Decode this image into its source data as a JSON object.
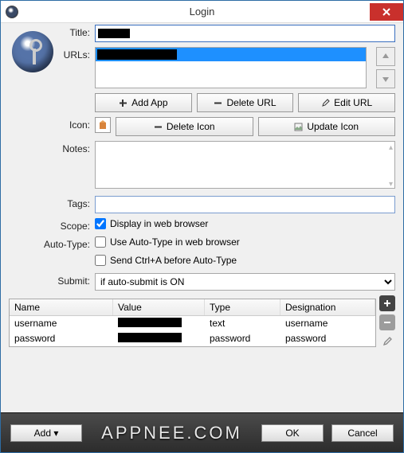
{
  "window": {
    "title": "Login"
  },
  "labels": {
    "title": "Title:",
    "urls": "URLs:",
    "icon": "Icon:",
    "notes": "Notes:",
    "tags": "Tags:",
    "scope": "Scope:",
    "autotype": "Auto-Type:",
    "submit": "Submit:"
  },
  "title_value": "█████",
  "buttons": {
    "add_app": "Add App",
    "delete_url": "Delete URL",
    "edit_url": "Edit URL",
    "delete_icon": "Delete Icon",
    "update_icon": "Update Icon"
  },
  "checks": {
    "display_browser": "Display in web browser",
    "use_autotype": "Use Auto-Type in web browser",
    "send_ctrl_a": "Send Ctrl+A before Auto-Type"
  },
  "check_states": {
    "display_browser": true,
    "use_autotype": false,
    "send_ctrl_a": false
  },
  "submit_value": "if auto-submit is ON",
  "grid": {
    "headers": {
      "name": "Name",
      "value": "Value",
      "type": "Type",
      "designation": "Designation"
    },
    "rows": [
      {
        "name": "username",
        "value": "██████████",
        "type": "text",
        "designation": "username"
      },
      {
        "name": "password",
        "value": "██████████",
        "type": "password",
        "designation": "password"
      }
    ]
  },
  "footer": {
    "add": "Add ▾",
    "brand": "APPNEE.COM",
    "ok": "OK",
    "cancel": "Cancel"
  }
}
